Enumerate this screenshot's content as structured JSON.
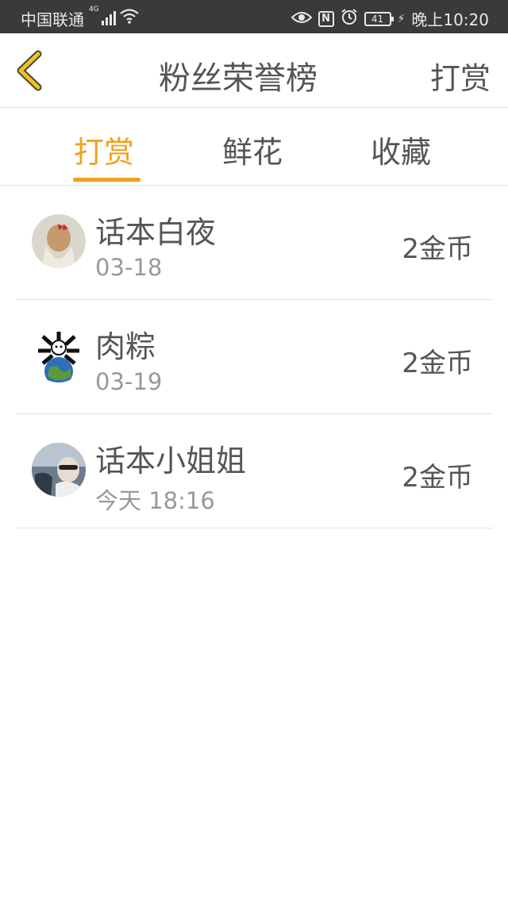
{
  "status_bar": {
    "carrier": "中国联通",
    "network": "4G",
    "battery": "41",
    "time": "晚上10:20"
  },
  "nav": {
    "title": "粉丝荣誉榜",
    "action": "打赏"
  },
  "tabs": [
    {
      "label": "打赏",
      "active": true
    },
    {
      "label": "鲜花",
      "active": false
    },
    {
      "label": "收藏",
      "active": false
    }
  ],
  "list": [
    {
      "name": "话本白夜",
      "date": "03-18",
      "amount": "2金币"
    },
    {
      "name": "肉粽",
      "date": "03-19",
      "amount": "2金币"
    },
    {
      "name": "话本小姐姐",
      "date": "今天 18:16",
      "amount": "2金币"
    }
  ],
  "colors": {
    "accent": "#f0a21a",
    "status_bar": "#3a3a3a",
    "text": "#555555",
    "subtext": "#999999"
  }
}
